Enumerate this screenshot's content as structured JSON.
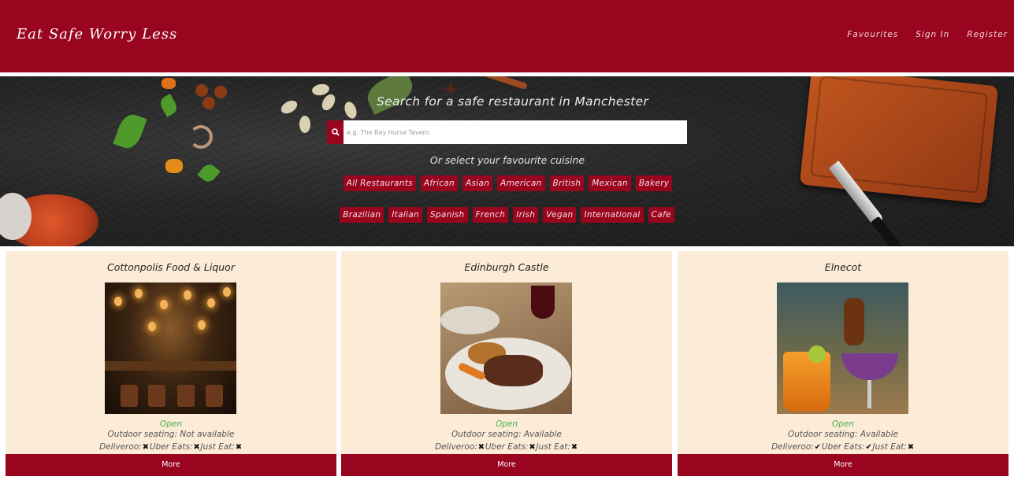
{
  "colors": {
    "brand": "#99041f",
    "card_bg": "#fcebd7",
    "open": "#4caf50"
  },
  "header": {
    "brand": "Eat Safe Worry Less",
    "links": [
      "Favourites",
      "Sign In",
      "Register"
    ]
  },
  "hero": {
    "title": "Search for a safe restaurant in Manchester",
    "search_placeholder": "e.g. The Bay Horse Tavern",
    "search_icon": "search-icon",
    "subtitle": "Or select your favourite cuisine",
    "cuisines_row1": [
      "All Restaurants",
      "African",
      "Asian",
      "American",
      "British",
      "Mexican",
      "Bakery"
    ],
    "cuisines_row2": [
      "Brazilian",
      "Italian",
      "Spanish",
      "French",
      "Irish",
      "Vegan",
      "International",
      "Cafe"
    ]
  },
  "cards": [
    {
      "name": "Cottonpolis Food & Liquor",
      "status": "Open",
      "seating": "Outdoor seating: Not available",
      "deliveroo_label": "Deliveroo:",
      "deliveroo": "✖",
      "uber_label": "Uber Eats:",
      "uber": "✖",
      "justeat_label": "Just Eat:",
      "justeat": "✖",
      "more": "More"
    },
    {
      "name": "Edinburgh Castle",
      "status": "Open",
      "seating": "Outdoor seating: Available",
      "deliveroo_label": "Deliveroo:",
      "deliveroo": "✖",
      "uber_label": "Uber Eats:",
      "uber": "✖",
      "justeat_label": "Just Eat:",
      "justeat": "✖",
      "more": "More"
    },
    {
      "name": "Elnecot",
      "status": "Open",
      "seating": "Outdoor seating: Available",
      "deliveroo_label": "Deliveroo:",
      "deliveroo": "✔",
      "uber_label": "Uber Eats:",
      "uber": "✔",
      "justeat_label": "Just Eat:",
      "justeat": "✖",
      "more": "More"
    }
  ]
}
